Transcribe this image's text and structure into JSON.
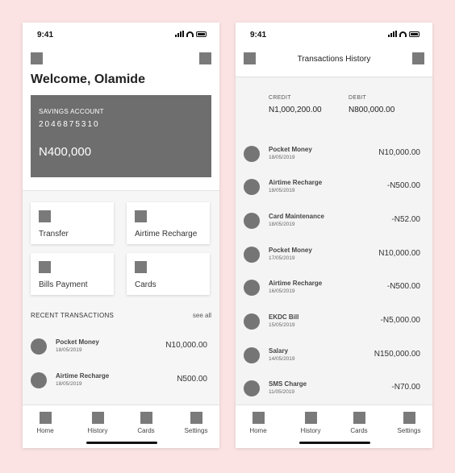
{
  "left": {
    "status_time": "9:41",
    "welcome": "Welcome, Olamide",
    "account": {
      "type": "SAVINGS ACCOUNT",
      "number": "2046875310",
      "balance": "N400,000"
    },
    "actions": [
      {
        "label": "Transfer"
      },
      {
        "label": "Airtime Recharge"
      },
      {
        "label": "Bills Payment"
      },
      {
        "label": "Cards"
      }
    ],
    "recent_heading": "RECENT TRANSACTIONS",
    "see_all": "see all",
    "transactions": [
      {
        "name": "Pocket Money",
        "date": "18/05/2019",
        "amount": "N10,000.00"
      },
      {
        "name": "Airtime Recharge",
        "date": "18/05/2019",
        "amount": "N500.00"
      }
    ]
  },
  "right": {
    "status_time": "9:41",
    "title": "Transactions History",
    "credit_label": "CREDIT",
    "credit_value": "N1,000,200.00",
    "debit_label": "DEBIT",
    "debit_value": "N800,000.00",
    "transactions": [
      {
        "name": "Pocket Money",
        "date": "18/05/2019",
        "amount": "N10,000.00"
      },
      {
        "name": "Airtime Recharge",
        "date": "18/05/2019",
        "amount": "-N500.00"
      },
      {
        "name": "Card Maintenance",
        "date": "18/05/2019",
        "amount": "-N52.00"
      },
      {
        "name": "Pocket Money",
        "date": "17/05/2019",
        "amount": "N10,000.00"
      },
      {
        "name": "Airtime Recharge",
        "date": "16/05/2019",
        "amount": "-N500.00"
      },
      {
        "name": "EKDC Bill",
        "date": "15/05/2019",
        "amount": "-N5,000.00"
      },
      {
        "name": "Salary",
        "date": "14/05/2019",
        "amount": "N150,000.00"
      },
      {
        "name": "SMS Charge",
        "date": "11/05/2019",
        "amount": "-N70.00"
      }
    ]
  },
  "nav": [
    {
      "label": "Home"
    },
    {
      "label": "History"
    },
    {
      "label": "Cards"
    },
    {
      "label": "Settings"
    }
  ],
  "colors": {
    "background": "#fbe3e3",
    "placeholder": "#7a7a7a",
    "card": "#6e6e6e"
  }
}
